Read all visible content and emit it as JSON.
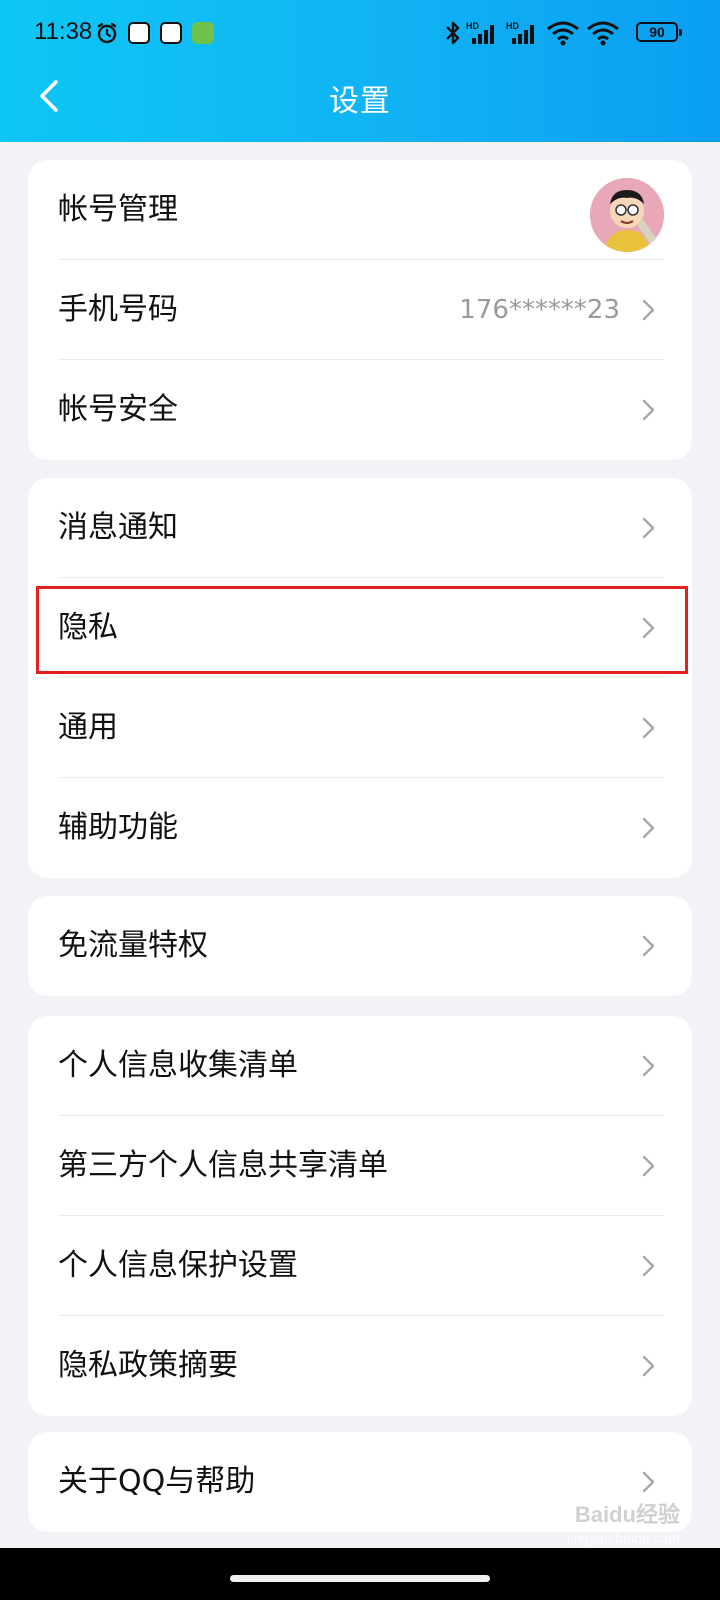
{
  "status_bar": {
    "time": "11:38",
    "battery": "90",
    "network_labels": [
      "HD",
      "HD"
    ]
  },
  "nav": {
    "title": "设置",
    "back_icon": "chevron-left-icon"
  },
  "groups": [
    {
      "items": [
        {
          "label": "帐号管理",
          "value": "",
          "trailing": "avatar"
        },
        {
          "label": "手机号码",
          "value": "176******23",
          "trailing": "chevron"
        },
        {
          "label": "帐号安全",
          "value": "",
          "trailing": "chevron"
        }
      ]
    },
    {
      "items": [
        {
          "label": "消息通知",
          "value": "",
          "trailing": "chevron"
        },
        {
          "label": "隐私",
          "value": "",
          "trailing": "chevron",
          "highlighted": true
        },
        {
          "label": "通用",
          "value": "",
          "trailing": "chevron"
        },
        {
          "label": "辅助功能",
          "value": "",
          "trailing": "chevron"
        }
      ]
    },
    {
      "items": [
        {
          "label": "免流量特权",
          "value": "",
          "trailing": "chevron"
        }
      ]
    },
    {
      "items": [
        {
          "label": "个人信息收集清单",
          "value": "",
          "trailing": "chevron"
        },
        {
          "label": "第三方个人信息共享清单",
          "value": "",
          "trailing": "chevron"
        },
        {
          "label": "个人信息保护设置",
          "value": "",
          "trailing": "chevron"
        },
        {
          "label": "隐私政策摘要",
          "value": "",
          "trailing": "chevron"
        }
      ]
    },
    {
      "items": [
        {
          "label": "关于QQ与帮助",
          "value": "",
          "trailing": "chevron"
        }
      ]
    }
  ],
  "watermark": {
    "brand": "Baidu经验",
    "url": "jingyan.baidu.com"
  },
  "colors": {
    "header_start": "#0ec7f5",
    "header_end": "#0a9ff1",
    "highlight": "#e4201e",
    "background": "#f2f3f7"
  }
}
